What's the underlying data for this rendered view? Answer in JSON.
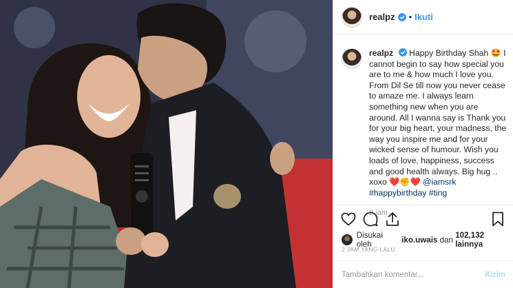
{
  "post": {
    "username": "realpz",
    "dot": "•",
    "follow_label": "Ikuti"
  },
  "caption": {
    "username": "realpz",
    "text_1": "Happy Birthday Shah 🤩 I cannot begin to say how special you are to me & how much I love you. From Dil Se till now you never cease to amaze me. I always learn something new when you are around. All I wanna say is Thank you for your big heart, your madness, the way you inspire me and for your wicked sense of humour. Wish you loads of love, happiness, success and good health always. Big hug .. xoxo ❤️✊❤️ ",
    "mention": "@iamsrk",
    "hashtags": "#happybirthday #ting",
    "time": "2 jam"
  },
  "likes": {
    "prefix": "Disukai oleh",
    "user": "iko.uwais",
    "middle": "dan",
    "count": "102,132 lainnya"
  },
  "posted_ago": "2 JAM YANG LALU",
  "comment": {
    "placeholder": "Tambahkan komentar...",
    "post_label": "Kirim"
  },
  "icons": {
    "like": "heart-icon",
    "comment": "comment-icon",
    "share": "share-icon",
    "save": "bookmark-icon",
    "verified": "verified-badge-icon"
  },
  "colors": {
    "accent": "#3897f0",
    "post_disabled": "#b2dffc",
    "muted": "#999999",
    "couch_red": "#b52c2c"
  }
}
